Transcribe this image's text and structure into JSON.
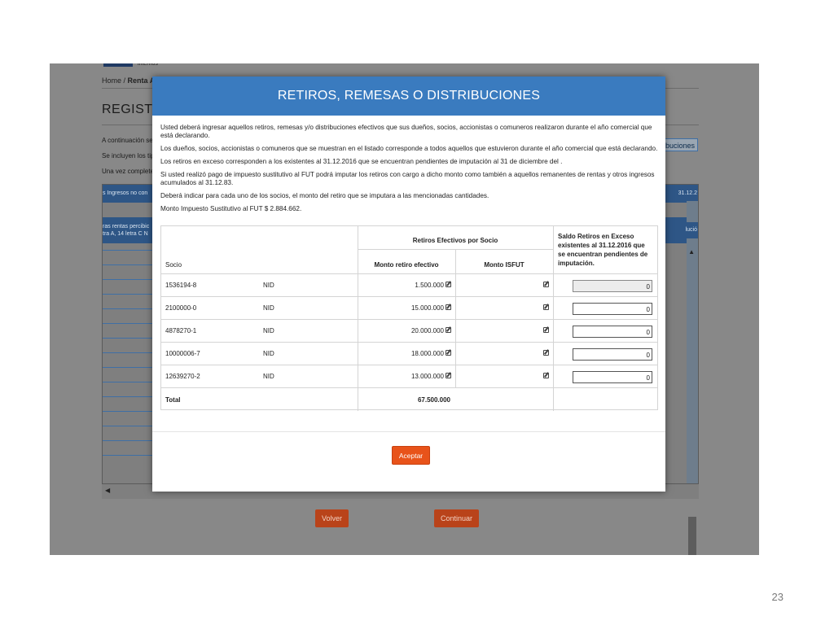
{
  "page_number": "23",
  "background": {
    "logo_subtext": "internos",
    "breadcrumb_home": "Home",
    "breadcrumb_current": "Renta A",
    "title": "REGISTR",
    "intro_lines": [
      "A continuación se",
      "Se incluyen los tip",
      "Una vez complete"
    ],
    "right_button": "ibuciones",
    "table_header_left": "s Ingresos no con",
    "table_header_right": "31.12.2",
    "table_row_left_1": "ras rentas percibic",
    "table_row_left_2": "tra A, 14 letra C N",
    "table_row_right": "lució",
    "volver_label": "Volver",
    "continuar_label": "Continuar"
  },
  "modal": {
    "title": "RETIROS, REMESAS O DISTRIBUCIONES",
    "paragraphs": [
      "Usted deberá ingresar aquellos retiros, remesas y/o distribuciones efectivos que sus dueños, socios, accionistas o comuneros realizaron durante el año comercial que está declarando.",
      "Los dueños, socios, accionistas o comuneros que se muestran en el listado corresponde a todos aquellos que estuvieron durante el año comercial que está declarando.",
      "Los retiros en exceso corresponden a los existentes al 31.12.2016 que se encuentran pendientes de imputación al 31 de diciembre del .",
      "Si usted realizó pago de impuesto sustitutivo al FUT podrá imputar los retiros con cargo a dicho monto como también a aquellos remanentes de rentas y otros ingresos acumulados al 31.12.83.",
      "Deberá indicar para cada uno de los socios, el monto del retiro que se imputara a las mencionadas cantidades.",
      "Monto Impuesto Sustitutivo al FUT $ 2.884.662."
    ],
    "table": {
      "col_socio": "Socio",
      "group_header": "Retiros Efectivos por Socio",
      "col_monto": "Monto retiro efectivo",
      "col_isfut": "Monto ISFUT",
      "col_saldo": "Saldo Retiros en Exceso existentes al 31.12.2016 que se encuentran pendientes de imputación.",
      "rows": [
        {
          "rut": "1536194-8",
          "tipo": "NID",
          "monto": "1.500.000",
          "saldo": "0"
        },
        {
          "rut": "2100000-0",
          "tipo": "NID",
          "monto": "15.000.000",
          "saldo": "0"
        },
        {
          "rut": "4878270-1",
          "tipo": "NID",
          "monto": "20.000.000",
          "saldo": "0"
        },
        {
          "rut": "10000006-7",
          "tipo": "NID",
          "monto": "18.000.000",
          "saldo": "0"
        },
        {
          "rut": "12639270-2",
          "tipo": "NID",
          "monto": "13.000.000",
          "saldo": "0"
        }
      ],
      "total_label": "Total",
      "total_value": "67.500.000"
    },
    "accept_label": "Aceptar"
  }
}
